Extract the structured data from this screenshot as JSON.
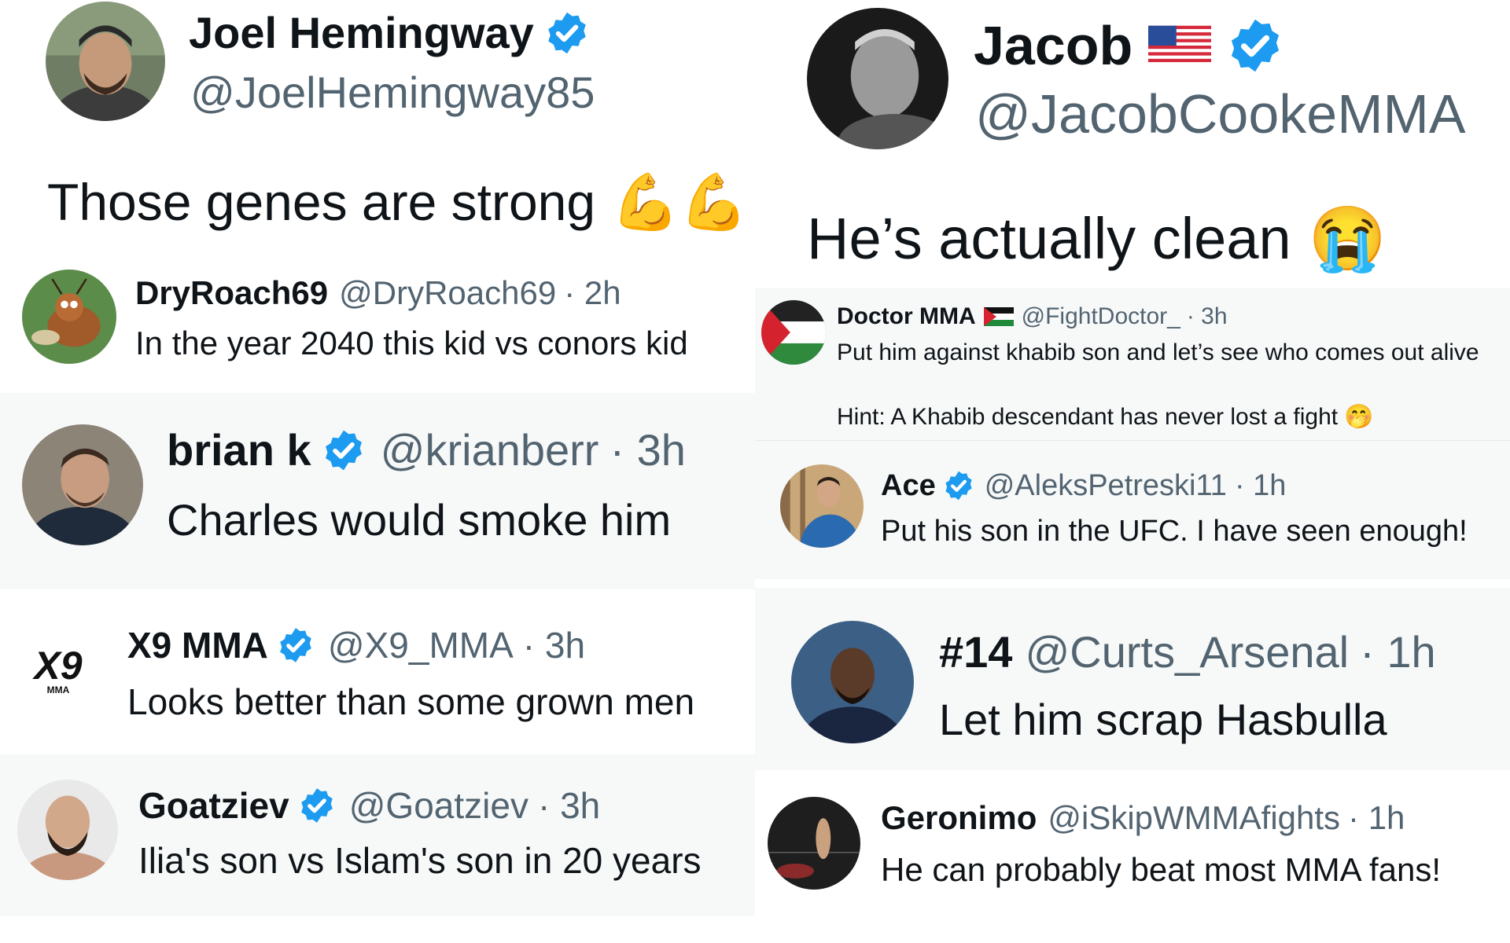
{
  "colors": {
    "verified": "#1d9bf0",
    "text": "#0f1419",
    "muted": "#536471",
    "bg_alt": "#f7f9f9"
  },
  "left": {
    "main_tweet": {
      "name": "Joel Hemingway",
      "handle": "@JoelHemingway85",
      "text": "Those genes are strong",
      "emoji": "💪💪",
      "verified": true
    },
    "replies": [
      {
        "name": "DryRoach69",
        "handle": "@DryRoach69",
        "time": "· 2h",
        "text": "In the year 2040 this kid vs conors kid",
        "verified": false
      },
      {
        "name": "brian k",
        "handle": "@krianberr",
        "time": "· 3h",
        "text": "Charles would smoke him",
        "verified": true
      },
      {
        "name": "X9 MMA",
        "handle": "@X9_MMA",
        "time": "· 3h",
        "text": "Looks better than some grown men",
        "verified": true,
        "logo_text": "X9",
        "logo_sub": "MMA"
      },
      {
        "name": "Goatziev",
        "handle": "@Goatziev",
        "time": "· 3h",
        "text": "Ilia's son vs Islam's son in 20 years",
        "verified": true
      }
    ]
  },
  "right": {
    "main_tweet": {
      "name": "Jacob",
      "handle": "@JacobCookeMMA",
      "text": "He’s actually clean",
      "emoji": "😭",
      "verified": true,
      "flag": "us-flag"
    },
    "replies": [
      {
        "name": "Doctor MMA",
        "handle": "@FightDoctor_",
        "time": "· 3h",
        "text": "Put him against khabib son and let’s see who comes out alive",
        "text2": "Hint: A Khabib descendant has never lost a fight",
        "emoji2": "🤭",
        "flag": "palestine-flag",
        "verified": false
      },
      {
        "name": "Ace",
        "handle": "@AleksPetreski11",
        "time": "· 1h",
        "text": "Put his son in the UFC. I have seen enough!",
        "verified": true
      },
      {
        "name": "#14",
        "handle": "@Curts_Arsenal",
        "time": "· 1h",
        "text": "Let him scrap Hasbulla",
        "verified": false
      },
      {
        "name": "Geronimo",
        "handle": "@iSkipWMMAfights",
        "time": "· 1h",
        "text": "He can probably beat most MMA fans!",
        "verified": false
      }
    ]
  }
}
